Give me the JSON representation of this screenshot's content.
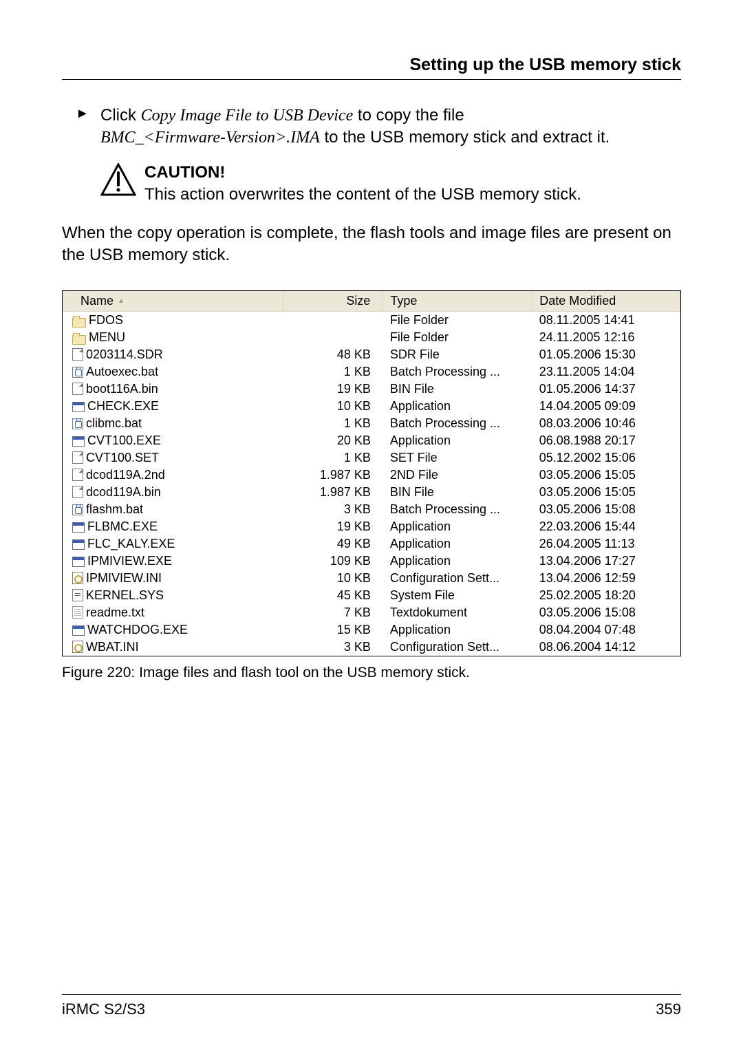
{
  "header": {
    "title": "Setting up the USB memory stick"
  },
  "body": {
    "instruction_pre": "Click ",
    "instruction_action": "Copy Image File to USB Device",
    "instruction_mid": " to copy the file ",
    "instruction_file": "BMC_<Firmware-Version>.IMA",
    "instruction_post": " to the USB memory stick and extract it."
  },
  "caution": {
    "title": "CAUTION!",
    "text": "This action overwrites the content of the USB memory stick."
  },
  "after_caution": "When the copy operation is complete, the flash tools and image files are present on the USB memory stick.",
  "table": {
    "headers": {
      "name": "Name",
      "size": "Size",
      "type": "Type",
      "date": "Date Modified"
    },
    "rows": [
      {
        "icon": "folder",
        "name": "FDOS",
        "size": "",
        "type": "File Folder",
        "date": "08.11.2005 14:41"
      },
      {
        "icon": "folder",
        "name": "MENU",
        "size": "",
        "type": "File Folder",
        "date": "24.11.2005 12:16"
      },
      {
        "icon": "file",
        "name": "0203114.SDR",
        "size": "48 KB",
        "type": "SDR File",
        "date": "01.05.2006 15:30"
      },
      {
        "icon": "bat",
        "name": "Autoexec.bat",
        "size": "1 KB",
        "type": "Batch Processing ...",
        "date": "23.11.2005 14:04"
      },
      {
        "icon": "file",
        "name": "boot116A.bin",
        "size": "19 KB",
        "type": "BIN File",
        "date": "01.05.2006 14:37"
      },
      {
        "icon": "exe",
        "name": "CHECK.EXE",
        "size": "10 KB",
        "type": "Application",
        "date": "14.04.2005 09:09"
      },
      {
        "icon": "bat",
        "name": "clibmc.bat",
        "size": "1 KB",
        "type": "Batch Processing ...",
        "date": "08.03.2006 10:46"
      },
      {
        "icon": "exe",
        "name": "CVT100.EXE",
        "size": "20 KB",
        "type": "Application",
        "date": "06.08.1988 20:17"
      },
      {
        "icon": "file",
        "name": "CVT100.SET",
        "size": "1 KB",
        "type": "SET File",
        "date": "05.12.2002 15:06"
      },
      {
        "icon": "file",
        "name": "dcod119A.2nd",
        "size": "1.987 KB",
        "type": "2ND File",
        "date": "03.05.2006 15:05"
      },
      {
        "icon": "file",
        "name": "dcod119A.bin",
        "size": "1.987 KB",
        "type": "BIN File",
        "date": "03.05.2006 15:05"
      },
      {
        "icon": "bat",
        "name": "flashm.bat",
        "size": "3 KB",
        "type": "Batch Processing ...",
        "date": "03.05.2006 15:08"
      },
      {
        "icon": "exe",
        "name": "FLBMC.EXE",
        "size": "19 KB",
        "type": "Application",
        "date": "22.03.2006 15:44"
      },
      {
        "icon": "exe",
        "name": "FLC_KALY.EXE",
        "size": "49 KB",
        "type": "Application",
        "date": "26.04.2005 11:13"
      },
      {
        "icon": "exe",
        "name": "IPMIVIEW.EXE",
        "size": "109 KB",
        "type": "Application",
        "date": "13.04.2006 17:27"
      },
      {
        "icon": "ini",
        "name": "IPMIVIEW.INI",
        "size": "10 KB",
        "type": "Configuration Sett...",
        "date": "13.04.2006 12:59"
      },
      {
        "icon": "sys",
        "name": "KERNEL.SYS",
        "size": "45 KB",
        "type": "System File",
        "date": "25.02.2005 18:20"
      },
      {
        "icon": "txt",
        "name": "readme.txt",
        "size": "7 KB",
        "type": "Textdokument",
        "date": "03.05.2006 15:08"
      },
      {
        "icon": "exe",
        "name": "WATCHDOG.EXE",
        "size": "15 KB",
        "type": "Application",
        "date": "08.04.2004 07:48"
      },
      {
        "icon": "ini",
        "name": "WBAT.INI",
        "size": "3 KB",
        "type": "Configuration Sett...",
        "date": "08.06.2004 14:12"
      }
    ]
  },
  "figure_caption": "Figure 220: Image files and flash tool on the USB memory stick.",
  "footer": {
    "left": "iRMC S2/S3",
    "right": "359"
  }
}
